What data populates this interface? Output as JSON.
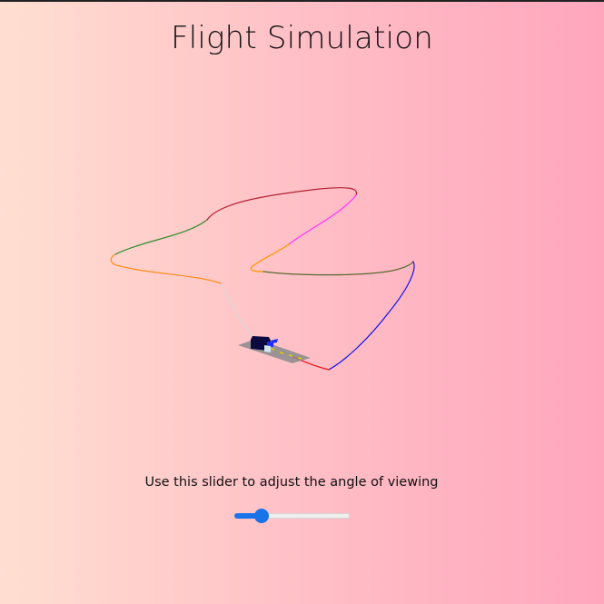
{
  "page": {
    "title": "Flight Simulation"
  },
  "viewer": {
    "caption": "Use this slider to adjust the angle of viewing",
    "angle_slider": {
      "value": 0.2,
      "min": 0,
      "max": 1,
      "accent_color": "#1a73e8"
    }
  },
  "flight_path": {
    "segment_colors": [
      "#d8d8d8",
      "#ff8c1a",
      "#2e8b2e",
      "#b22234",
      "#ff33ff",
      "#ff9900",
      "#556b2f",
      "#1111ee",
      "#ee1111"
    ],
    "runway_color": "#8a8a8a",
    "aircraft_color": "#0b0b40"
  }
}
